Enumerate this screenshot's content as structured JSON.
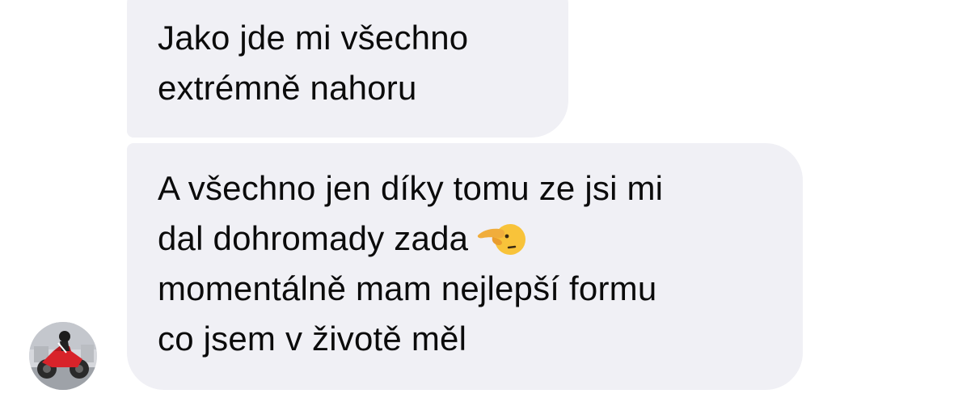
{
  "messages": [
    {
      "lines": [
        "Jako jde mi všechno",
        "extrémně nahoru"
      ]
    },
    {
      "lines": [
        "A všechno jen díky tomu ze jsi mi",
        "dal dohromady zada",
        "momentálně mam nejlepší formu",
        "co jsem v životě měl"
      ],
      "emoji": "face-with-hand-pointing-icon"
    }
  ],
  "avatar": {
    "icon": "motorcycle-rider-avatar-icon"
  },
  "colors": {
    "bubble": "#f0f0f5",
    "text": "#0b0b0b",
    "background": "#ffffff"
  }
}
